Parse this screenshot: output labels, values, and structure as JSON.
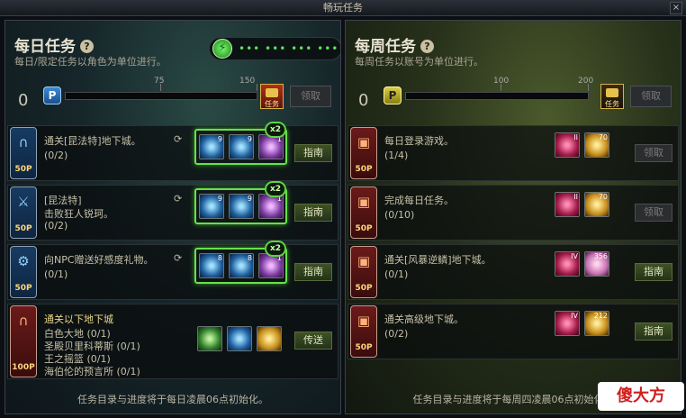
{
  "window": {
    "title": "畅玩任务",
    "close_label": "×"
  },
  "daily": {
    "title": "每日任务",
    "subtitle": "每日/限定任务以角色为单位进行。",
    "points": "0",
    "p_label": "P",
    "ticks": [
      "75",
      "150"
    ],
    "progress_fraction": 0.0,
    "chest_label": "任务",
    "claim_label": "领取",
    "fatigue_dots": "••• ••• ••• •••",
    "footer": "任务目录与进度将于每日凌晨06点初始化。",
    "tasks": [
      {
        "points": "50P",
        "title": "通关[昆法特]地下城。",
        "progress": "(0/2)",
        "items": [
          {
            "count": "9"
          },
          {
            "count": "9"
          },
          {
            "count": "1"
          }
        ],
        "multiplier": "x2",
        "action": "指南"
      },
      {
        "points": "50P",
        "title": "[昆法特]",
        "line2": "击败狂人锐珂。",
        "progress": "(0/2)",
        "items": [
          {
            "count": "9"
          },
          {
            "count": "9"
          },
          {
            "count": "1"
          }
        ],
        "multiplier": "x2",
        "action": "指南"
      },
      {
        "points": "50P",
        "title": "向NPC赠送好感度礼物。",
        "progress": "(0/1)",
        "items": [
          {
            "count": "8"
          },
          {
            "count": "8"
          },
          {
            "count": "1"
          }
        ],
        "multiplier": "x2",
        "action": "指南"
      },
      {
        "points": "100P",
        "title": "通关以下地下城",
        "lines": [
          "白色大地 (0/1)",
          "圣殿贝里科蒂斯 (0/1)",
          "王之摇篮 (0/1)",
          "海伯伦的预言所 (0/1)"
        ],
        "action": "传送"
      }
    ]
  },
  "weekly": {
    "title": "每周任务",
    "subtitle": "每周任务以账号为单位进行。",
    "points": "0",
    "p_label": "P",
    "ticks": [
      "100",
      "200"
    ],
    "progress_fraction": 0.0,
    "chest_label": "任务",
    "claim_label": "领取",
    "footer": "任务目录与进度将于每周四凌晨06点初始化。",
    "tasks": [
      {
        "points": "50P",
        "title": "每日登录游戏。",
        "progress": "(1/4)",
        "items": [
          {
            "count": "II"
          },
          {
            "count": "70"
          }
        ],
        "action": "领取",
        "disabled": true
      },
      {
        "points": "50P",
        "title": "完成每日任务。",
        "progress": "(0/10)",
        "items": [
          {
            "count": "II"
          },
          {
            "count": "70"
          }
        ],
        "action": "领取",
        "disabled": true
      },
      {
        "points": "50P",
        "title": "通关[风暴逆鳞]地下城。",
        "progress": "(0/1)",
        "items": [
          {
            "count": "IV"
          },
          {
            "count": "356"
          }
        ],
        "action": "指南"
      },
      {
        "points": "50P",
        "title": "通关高级地下城。",
        "progress": "(0/2)",
        "items": [
          {
            "count": "IV"
          },
          {
            "count": "212"
          }
        ],
        "action": "指南"
      }
    ]
  },
  "watermark": "傻大方"
}
